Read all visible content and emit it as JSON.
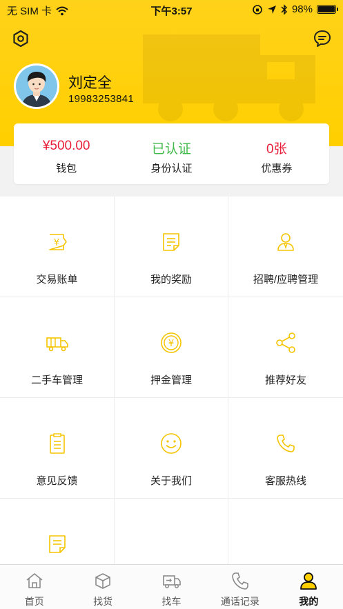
{
  "status_bar": {
    "carrier": "无 SIM 卡",
    "time": "下午3:57",
    "battery": "98%",
    "battery_level": 0.98
  },
  "user": {
    "name": "刘定全",
    "phone": "19983253841"
  },
  "stats": [
    {
      "value": "¥500.00",
      "label": "钱包"
    },
    {
      "value": "已认证",
      "label": "身份认证"
    },
    {
      "value": "0张",
      "label": "优惠券"
    }
  ],
  "menu": [
    {
      "label": "交易账单",
      "icon": "bill-icon"
    },
    {
      "label": "我的奖励",
      "icon": "reward-icon"
    },
    {
      "label": "招聘/应聘管理",
      "icon": "recruit-icon"
    },
    {
      "label": "二手车管理",
      "icon": "truck-icon"
    },
    {
      "label": "押金管理",
      "icon": "deposit-icon"
    },
    {
      "label": "推荐好友",
      "icon": "share-icon"
    },
    {
      "label": "意见反馈",
      "icon": "feedback-icon"
    },
    {
      "label": "关于我们",
      "icon": "smile-icon"
    },
    {
      "label": "客服热线",
      "icon": "phone-icon"
    },
    {
      "label": "",
      "icon": "note-icon"
    }
  ],
  "tabs": [
    {
      "label": "首页",
      "icon": "home-icon"
    },
    {
      "label": "找货",
      "icon": "box-icon"
    },
    {
      "label": "找车",
      "icon": "truck-icon"
    },
    {
      "label": "通话记录",
      "icon": "phone-icon"
    },
    {
      "label": "我的",
      "icon": "user-icon",
      "active": true
    }
  ],
  "colors": {
    "brand_yellow": "#ffcf00",
    "icon_yellow": "#f5c400",
    "price_red": "#e8203a",
    "verified_green": "#3fb94a"
  }
}
